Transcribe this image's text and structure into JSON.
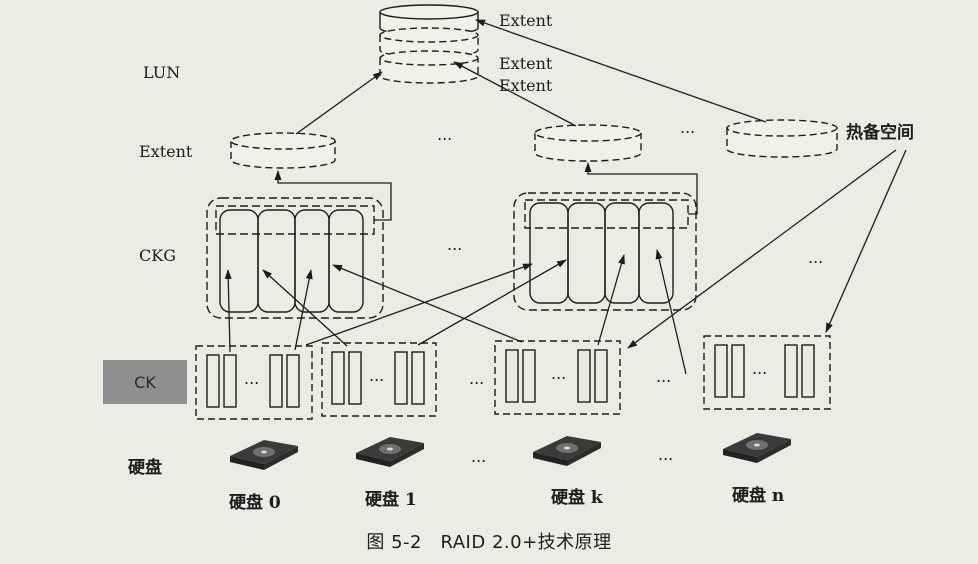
{
  "levels": {
    "lun": "LUN",
    "extent": "Extent",
    "ckg": "CKG",
    "ck": "CK",
    "disk": "硬盘"
  },
  "extent_labels": [
    "Extent",
    "Extent",
    "Extent"
  ],
  "hot_spare": "热备空间",
  "ellipsis": "...",
  "ck_ellipsis": "...",
  "disks": [
    "硬盘 0",
    "硬盘 1",
    "硬盘 k",
    "硬盘 n"
  ],
  "caption": "图 5-2　RAID 2.0+技术原理"
}
